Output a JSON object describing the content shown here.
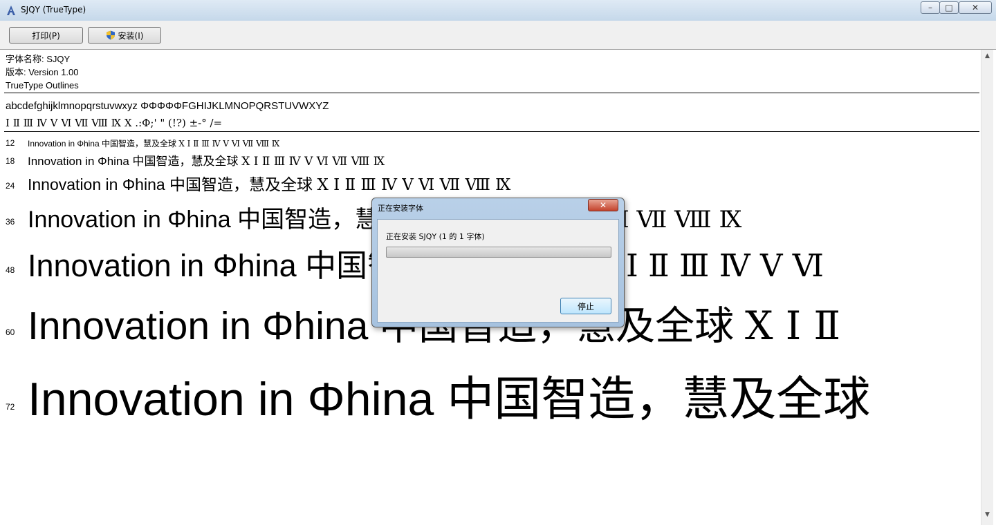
{
  "window": {
    "title": "SJQY (TrueType)",
    "controls": {
      "minimize": "–",
      "maximize": "□",
      "close": "✕"
    }
  },
  "toolbar": {
    "print_label": "打印(P)",
    "install_label": "安装(I)"
  },
  "font_info": {
    "name_line": "字体名称: SJQY",
    "version_line": "版本: Version 1.00",
    "type_line": "TrueType Outlines"
  },
  "charset": {
    "line1": "abcdefghijklmnopqrstuvwxyz ΦΦΦΦΦFGHIJKLMNOPQRSTUVWXYZ",
    "line2": "Ⅰ Ⅱ Ⅲ Ⅳ Ⅴ Ⅵ Ⅶ Ⅷ Ⅸ Ⅹ .:Φ;' \" (!?) ±-° /="
  },
  "samples": [
    {
      "size": "12",
      "text": "Innovation in Φhina 中国智造，慧及全球",
      "numerals": "Ⅹ Ⅰ Ⅱ Ⅲ Ⅳ Ⅴ Ⅵ Ⅶ Ⅷ Ⅸ"
    },
    {
      "size": "18",
      "text": "Innovation in Φhina 中国智造，慧及全球",
      "numerals": "Ⅹ Ⅰ Ⅱ Ⅲ Ⅳ Ⅴ Ⅵ Ⅶ Ⅷ Ⅸ"
    },
    {
      "size": "24",
      "text": "Innovation in Φhina 中国智造，慧及全球",
      "numerals": "Ⅹ Ⅰ Ⅱ Ⅲ Ⅳ Ⅴ Ⅵ Ⅶ Ⅷ Ⅸ"
    },
    {
      "size": "36",
      "text": "Innovation in Φhina 中国智造，慧及全球",
      "numerals": "Ⅹ Ⅰ Ⅱ Ⅲ Ⅳ Ⅴ Ⅵ Ⅶ Ⅷ Ⅸ"
    },
    {
      "size": "48",
      "text": "Innovation in Φhina 中国智造，慧及全球",
      "numerals": "Ⅹ Ⅰ Ⅱ Ⅲ Ⅳ Ⅴ Ⅵ"
    },
    {
      "size": "60",
      "text": "Innovation in Φhina 中国智造，慧及全球",
      "numerals": "Ⅹ Ⅰ Ⅱ"
    },
    {
      "size": "72",
      "text": "Innovation in Φhina 中国智造，慧及全球",
      "numerals": ""
    }
  ],
  "dialog": {
    "title": "正在安装字体",
    "message": "正在安装 SJQY (1 的 1 字体)",
    "progress_fraction": 0.0,
    "stop_label": "停止",
    "close_glyph": "✕"
  },
  "scrollbar": {
    "up": "▲",
    "down": "▼"
  }
}
